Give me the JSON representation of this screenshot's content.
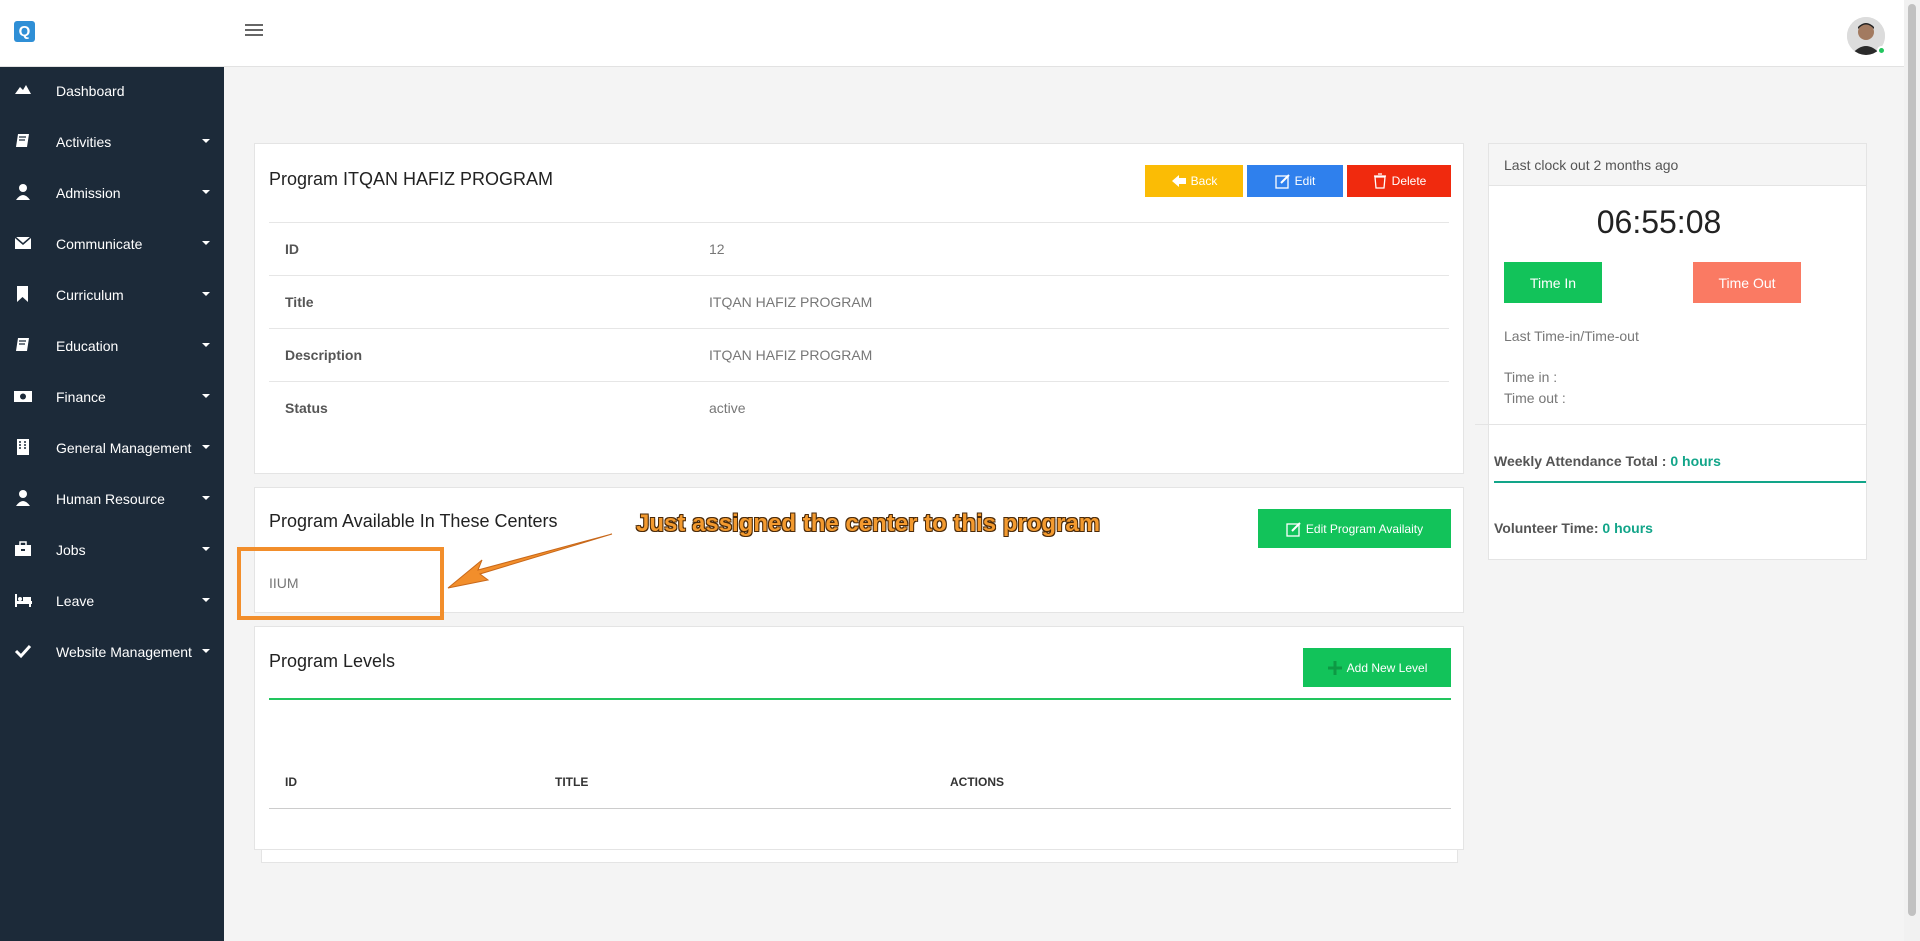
{
  "header": {
    "logo_letter": "Q"
  },
  "sidebar": {
    "items": [
      {
        "label": "Dashboard",
        "icon": "dashboard-icon"
      },
      {
        "label": "Activities",
        "icon": "book-icon"
      },
      {
        "label": "Admission",
        "icon": "user-icon"
      },
      {
        "label": "Communicate",
        "icon": "envelope-icon"
      },
      {
        "label": "Curriculum",
        "icon": "bookmark-icon"
      },
      {
        "label": "Education",
        "icon": "book-icon"
      },
      {
        "label": "Finance",
        "icon": "money-icon"
      },
      {
        "label": "General Management",
        "icon": "building-icon"
      },
      {
        "label": "Human Resource",
        "icon": "user-icon"
      },
      {
        "label": "Jobs",
        "icon": "briefcase-icon"
      },
      {
        "label": "Leave",
        "icon": "bed-icon"
      },
      {
        "label": "Website Management",
        "icon": "check-icon"
      }
    ]
  },
  "program": {
    "title": "Program ITQAN HAFIZ PROGRAM",
    "buttons": {
      "back": "Back",
      "edit": "Edit",
      "delete": "Delete"
    },
    "fields": [
      {
        "key": "ID",
        "value": "12"
      },
      {
        "key": "Title",
        "value": "ITQAN HAFIZ PROGRAM"
      },
      {
        "key": "Description",
        "value": "ITQAN HAFIZ PROGRAM"
      },
      {
        "key": "Status",
        "value": "active"
      }
    ]
  },
  "centers": {
    "title": "Program Available In These Centers",
    "edit_button": "Edit Program Availaity",
    "items": [
      "IIUM"
    ]
  },
  "annotation": {
    "text": "Just assigned the center to this program"
  },
  "levels": {
    "title": "Program Levels",
    "add_button": "Add New Level",
    "columns": [
      "ID",
      "TITLE",
      "ACTIONS"
    ]
  },
  "clock": {
    "header": "Last clock out 2 months ago",
    "time": "06:55:08",
    "time_in_button": "Time In",
    "time_out_button": "Time Out",
    "last_label": "Last Time-in/Time-out",
    "time_in_label": "Time in :",
    "time_out_label": "Time out :",
    "weekly_label": "Weekly Attendance Total :",
    "weekly_value": "0 hours",
    "volunteer_label": "Volunteer Time:",
    "volunteer_value": "0 hours",
    "accent_color": "#12a589"
  }
}
